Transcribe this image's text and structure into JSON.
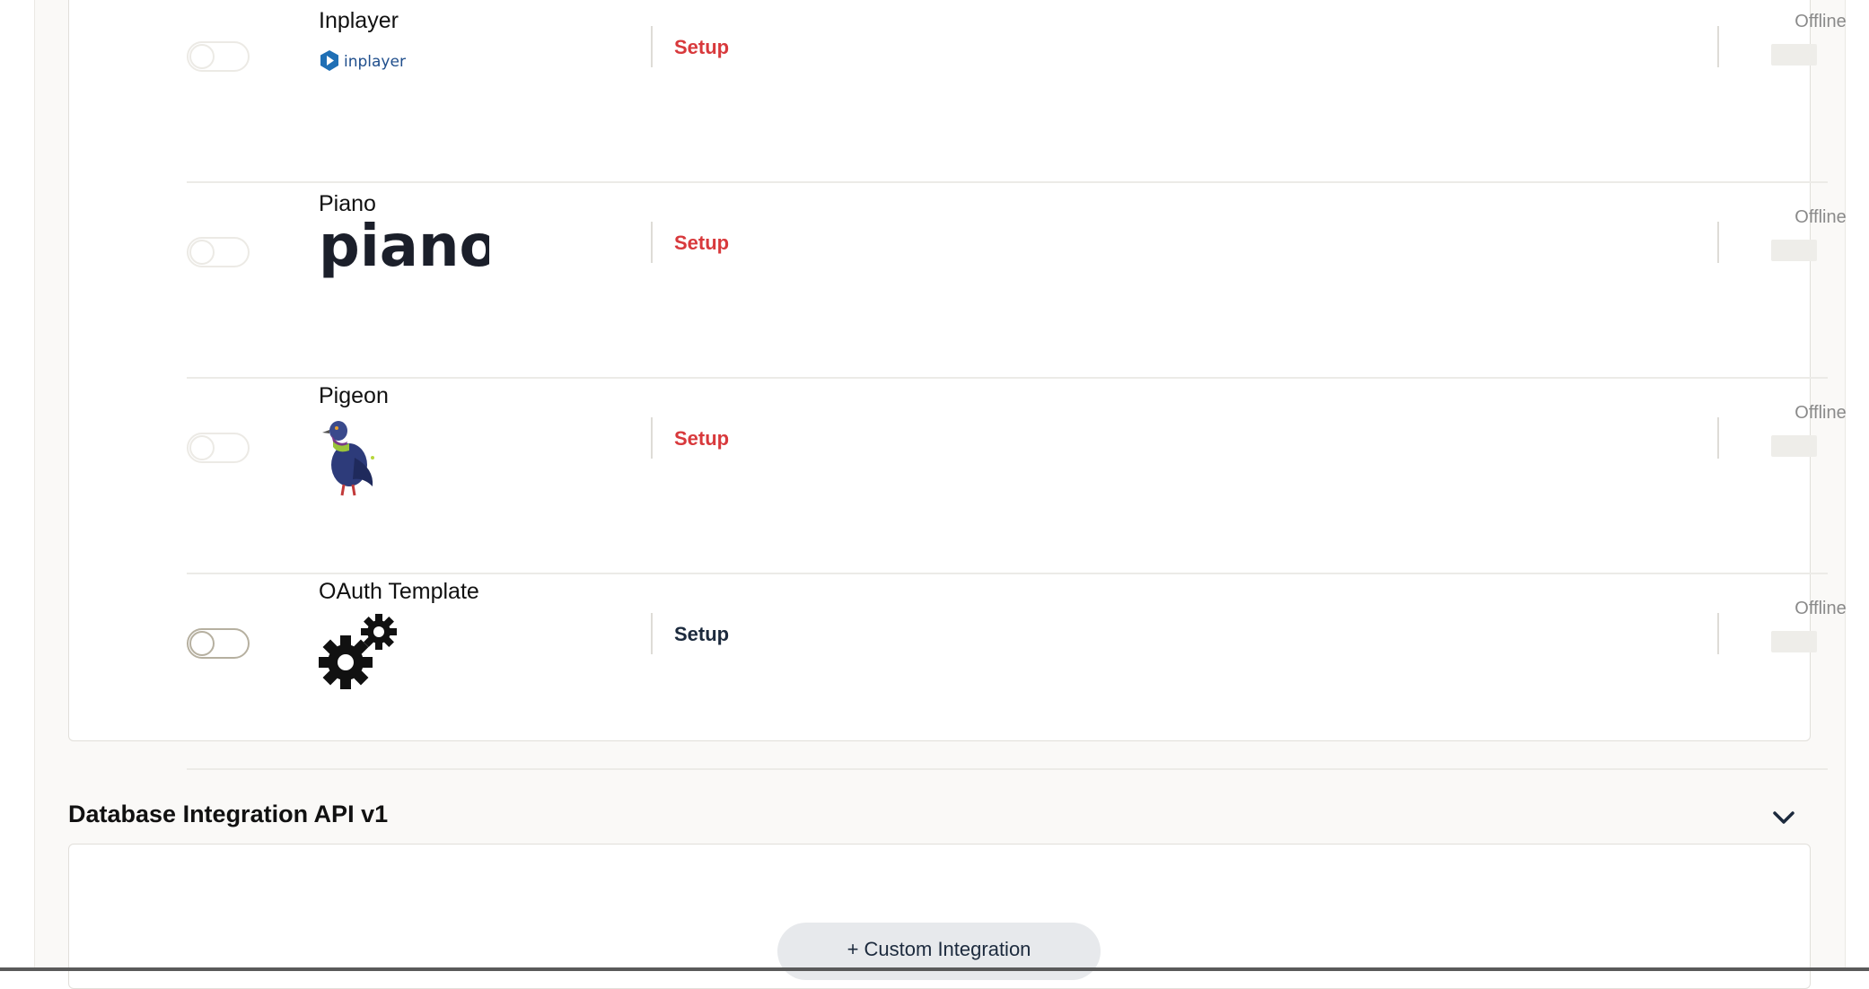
{
  "integrations": [
    {
      "name": "Inplayer",
      "logo_text": "inplayer",
      "action": "Setup",
      "status": "Offline",
      "enabled": false
    },
    {
      "name": "Piano",
      "logo_text": "piano",
      "action": "Setup",
      "status": "Offline",
      "enabled": false
    },
    {
      "name": "Pigeon",
      "action": "Setup",
      "status": "Offline",
      "enabled": false
    },
    {
      "name": "OAuth Template",
      "action": "Setup",
      "status": "Offline",
      "enabled": false
    }
  ],
  "section": {
    "title": "Database Integration API v1",
    "custom_button": "+ Custom Integration"
  },
  "colors": {
    "setup_inactive": "#d8393c",
    "setup_active": "#1c2a3d",
    "status_text": "#8a8a8a"
  }
}
